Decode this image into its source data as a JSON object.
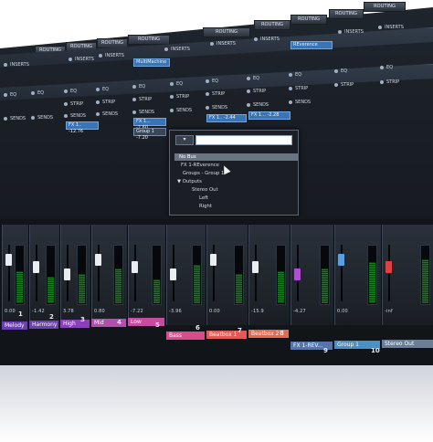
{
  "routing_tabs": [
    "ROUTING",
    "ROUTING",
    "ROUTING",
    "ROUTING",
    "ROUTING",
    "ROUTING",
    "ROUTING",
    "ROUTING",
    "ROUTING"
  ],
  "inserts": {
    "label": "INSERTS",
    "items": [
      "INSERTS",
      "INSERTS",
      "INSERTS",
      "INSERTS",
      "INSERTS",
      "INSERTS",
      "INSERTS",
      "INSERTS"
    ],
    "plugin_a": "MultiMachine",
    "plugin_b": "REverence"
  },
  "eq": {
    "items": [
      "EQ",
      "EQ",
      "EQ",
      "EQ",
      "EQ",
      "EQ",
      "EQ",
      "EQ",
      "EQ",
      "EQ",
      "EQ"
    ]
  },
  "strip": {
    "items": [
      "STRIP",
      "STRIP",
      "STRIP",
      "STRIP",
      "STRIP",
      "STRIP",
      "STRIP",
      "STRIP",
      "STRIP"
    ]
  },
  "sends": {
    "items": [
      "SENDS",
      "SENDS",
      "SENDS",
      "SENDS",
      "SENDS",
      "SENDS",
      "SENDS",
      "SENDS",
      "SENDS"
    ],
    "fx_a": "FX 1..",
    "fx_a_val": "-12.76",
    "fx_b": "FX 1...",
    "fx_b_val": "-2.60",
    "fx_c": "FX 1..",
    "fx_c_val": "-2.44",
    "fx_d": "FX 1...",
    "fx_d_val": "-2.28",
    "group_label": "Group 1",
    "group_val": "-7.20"
  },
  "bus_popup": {
    "items": {
      "no_bus": "No Bus",
      "fx": "FX 1-REverence",
      "groups": "Groups - Group 1",
      "outputs": "Outputs",
      "stereo": "Stereo Out",
      "left": "Left",
      "right": "Right"
    }
  },
  "channels": {
    "names": [
      "Melody",
      "Harmony",
      "High",
      "Mid",
      "Low",
      "Bass",
      "Beatbox 1",
      "Beatbox 2",
      "FX 1-REV...",
      "Group 1",
      "Stereo Out"
    ],
    "numbers": [
      "1",
      "2",
      "3",
      "4",
      "5",
      "6",
      "7",
      "8",
      "9",
      "10"
    ],
    "colors": [
      "#6a3fb0",
      "#6b40b4",
      "#8b3fb9",
      "#b04fae",
      "#c84ba2",
      "#d84c8c",
      "#e15a56",
      "#e06a52",
      "#5674a8",
      "#4a8fc5",
      "#6b7e96"
    ],
    "values": [
      "0.00",
      "-1.42",
      "3.78",
      "0.80",
      "-7.22",
      "-3.96",
      "0.00",
      "-15.9",
      "-4.27",
      "0.00",
      "-inf"
    ],
    "meter_levels": [
      0.55,
      0.45,
      0.5,
      0.6,
      0.4,
      0.65,
      0.5,
      0.55,
      0.6,
      0.7,
      0.75
    ]
  }
}
